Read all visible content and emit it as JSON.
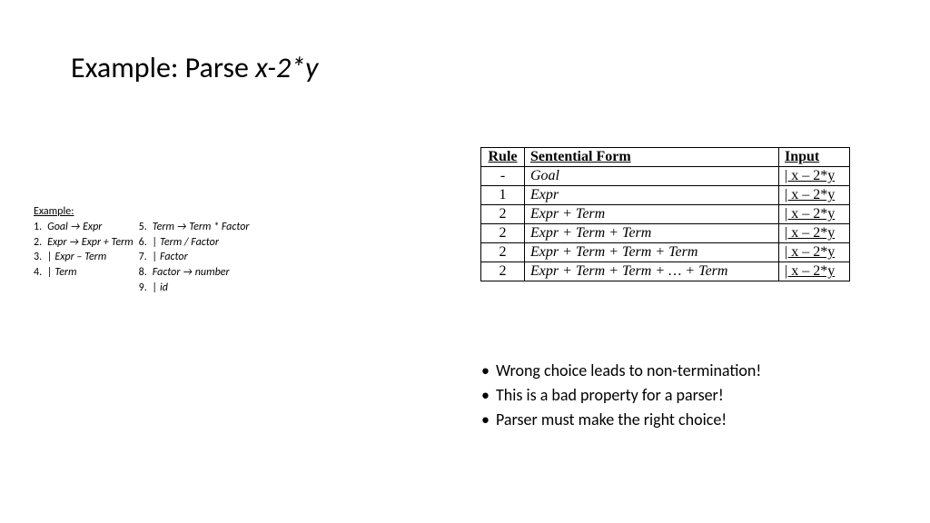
{
  "title": {
    "prefix": "Example: Parse ",
    "expr": "x-2*y"
  },
  "grammar": {
    "heading": "Example:",
    "rows": [
      {
        "l_num": "1.",
        "l_body": "Goal → Expr",
        "r_num": "5.",
        "r_body": "Term → Term * Factor"
      },
      {
        "l_num": "2.",
        "l_body": "Expr → Expr + Term",
        "r_num": "6.",
        "r_body": "        |  Term / Factor"
      },
      {
        "l_num": "3.",
        "l_body": "          |  Expr – Term",
        "r_num": "7.",
        "r_body": "        |  Factor"
      },
      {
        "l_num": "4.",
        "l_body": "          |  Term",
        "r_num": "8.",
        "r_body": "Factor → number"
      },
      {
        "l_num": "",
        "l_body": "",
        "r_num": "9.",
        "r_body": "           | id"
      }
    ]
  },
  "parse_table": {
    "headers": {
      "rule": "Rule",
      "form": "Sentential Form",
      "input": "Input"
    },
    "rows": [
      {
        "rule": "-",
        "form": "Goal",
        "input": "| x – 2*y"
      },
      {
        "rule": "1",
        "form": "Expr",
        "input": "| x – 2*y"
      },
      {
        "rule": "2",
        "form": "Expr + Term",
        "input": "| x – 2*y"
      },
      {
        "rule": "2",
        "form": "Expr + Term + Term",
        "input": "| x – 2*y"
      },
      {
        "rule": "2",
        "form": "Expr + Term + Term + Term",
        "input": "| x – 2*y"
      },
      {
        "rule": "2",
        "form": "Expr + Term + Term + … + Term",
        "input": "| x – 2*y"
      }
    ]
  },
  "bullets": [
    "Wrong choice leads to non-termination!",
    "This is a bad property for a parser!",
    "Parser must make the right choice!"
  ]
}
